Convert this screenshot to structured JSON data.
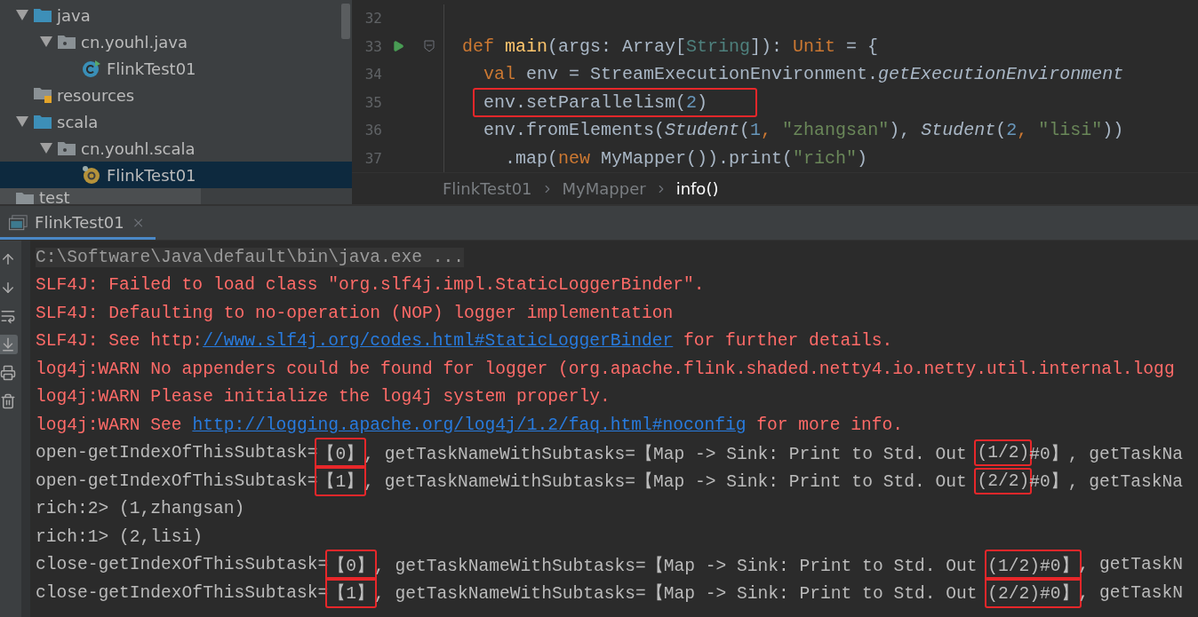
{
  "project_tree": [
    {
      "label": "java",
      "kind": "folder",
      "expanded": true,
      "selected": false,
      "children": [
        {
          "label": "cn.youhl.java",
          "kind": "package",
          "expanded": true,
          "selected": false,
          "children": [
            {
              "label": "FlinkTest01",
              "kind": "class",
              "selected": false
            }
          ]
        }
      ]
    },
    {
      "label": "resources",
      "kind": "resources",
      "selected": false
    },
    {
      "label": "scala",
      "kind": "folder",
      "expanded": true,
      "selected": false,
      "children": [
        {
          "label": "cn.youhl.scala",
          "kind": "package",
          "expanded": true,
          "selected": false,
          "children": [
            {
              "label": "FlinkTest01",
              "kind": "object",
              "selected": true
            }
          ]
        }
      ]
    }
  ],
  "tree_cut_row": {
    "label": "test"
  },
  "editor": {
    "lines": [
      {
        "number": "32",
        "run": false,
        "fold": false,
        "highlighted": false
      },
      {
        "number": "33",
        "run": true,
        "fold": true,
        "highlighted": false,
        "tokens": [
          {
            "kind": "keyword",
            "text": "def "
          },
          {
            "kind": "function",
            "text": "main"
          },
          {
            "kind": "plain",
            "text": "(args: Array["
          },
          {
            "kind": "type",
            "text": "String"
          },
          {
            "kind": "plain",
            "text": "]): "
          },
          {
            "kind": "keyword",
            "text": "Unit"
          },
          {
            "kind": "plain",
            "text": " = {"
          }
        ],
        "children": [
          {
            "number": "34",
            "run": false,
            "fold": false,
            "highlighted": false,
            "tokens": [
              {
                "kind": "keyword",
                "text": "val "
              },
              {
                "kind": "plain",
                "text": "env = StreamExecutionEnvironment."
              },
              {
                "kind": "italic",
                "text": "getExecutionEnvironment"
              }
            ]
          },
          {
            "number": "35",
            "run": false,
            "fold": false,
            "highlighted": true,
            "tokens": [
              {
                "kind": "plain",
                "text": "env.setParallelism("
              },
              {
                "kind": "number",
                "text": "2"
              },
              {
                "kind": "plain",
                "text": ")"
              }
            ]
          },
          {
            "number": "36",
            "run": false,
            "fold": false,
            "highlighted": false,
            "tokens": [
              {
                "kind": "plain",
                "text": "env.fromElements("
              },
              {
                "kind": "italic",
                "text": "Student"
              },
              {
                "kind": "plain",
                "text": "("
              },
              {
                "kind": "number",
                "text": "1"
              },
              {
                "kind": "keyword",
                "text": ", "
              },
              {
                "kind": "string",
                "text": "\"zhangsan\""
              },
              {
                "kind": "plain",
                "text": "), "
              },
              {
                "kind": "italic",
                "text": "Student"
              },
              {
                "kind": "plain",
                "text": "("
              },
              {
                "kind": "number",
                "text": "2"
              },
              {
                "kind": "keyword",
                "text": ", "
              },
              {
                "kind": "string",
                "text": "\"lisi\""
              },
              {
                "kind": "plain",
                "text": "))"
              }
            ],
            "children": [
              {
                "number": "37",
                "run": false,
                "fold": false,
                "highlighted": false,
                "tokens": [
                  {
                    "kind": "plain",
                    "text": ".map("
                  },
                  {
                    "kind": "keyword",
                    "text": "new "
                  },
                  {
                    "kind": "plain",
                    "text": "MyMapper()).print("
                  },
                  {
                    "kind": "string",
                    "text": "\"rich\""
                  },
                  {
                    "kind": "plain",
                    "text": ")"
                  }
                ]
              }
            ]
          }
        ]
      }
    ]
  },
  "breadcrumbs": [
    {
      "label": "FlinkTest01",
      "selected": false
    },
    {
      "label": "MyMapper",
      "selected": false
    },
    {
      "label": "info()",
      "selected": true
    }
  ],
  "run_tab": {
    "title": "FlinkTest01"
  },
  "console_lines": [
    {
      "kind": "command",
      "segments": [
        {
          "kind": "text",
          "text": "C:\\Software\\Java\\default\\bin\\java.exe ..."
        }
      ]
    },
    {
      "kind": "error",
      "segments": [
        {
          "kind": "text",
          "text": "SLF4J: Failed to load class \"org.slf4j.impl.StaticLoggerBinder\"."
        }
      ]
    },
    {
      "kind": "error",
      "segments": [
        {
          "kind": "text",
          "text": "SLF4J: Defaulting to no-operation (NOP) logger implementation"
        }
      ]
    },
    {
      "kind": "error",
      "segments": [
        {
          "kind": "text",
          "text": "SLF4J: See http:"
        },
        {
          "kind": "link",
          "text": "//www.slf4j.org/codes.html#StaticLoggerBinder"
        },
        {
          "kind": "text",
          "text": " for further details."
        }
      ]
    },
    {
      "kind": "error",
      "segments": [
        {
          "kind": "text",
          "text": "log4j:WARN No appenders could be found for logger (org.apache.flink.shaded.netty4.io.netty.util.internal.logg"
        }
      ]
    },
    {
      "kind": "error",
      "segments": [
        {
          "kind": "text",
          "text": "log4j:WARN Please initialize the log4j system properly."
        }
      ]
    },
    {
      "kind": "error",
      "segments": [
        {
          "kind": "text",
          "text": "log4j:WARN See "
        },
        {
          "kind": "link",
          "text": "http://logging.apache.org/log4j/1.2/faq.html#noconfig"
        },
        {
          "kind": "text",
          "text": " for more info."
        }
      ]
    },
    {
      "kind": "output",
      "segments": [
        {
          "kind": "text",
          "text": "open-getIndexOfThisSubtask=",
          "boxed": false
        },
        {
          "kind": "text",
          "text": "【0】",
          "boxed": true
        },
        {
          "kind": "text",
          "text": ", getTaskNameWithSubtasks=【Map -> Sink: Print to Std. Out ",
          "boxed": false
        },
        {
          "kind": "text",
          "text": "(1/2)",
          "boxed": true
        },
        {
          "kind": "text",
          "text": "#0】, getTaskNa",
          "boxed": false
        }
      ]
    },
    {
      "kind": "output",
      "segments": [
        {
          "kind": "text",
          "text": "open-getIndexOfThisSubtask=",
          "boxed": false
        },
        {
          "kind": "text",
          "text": "【1】",
          "boxed": true
        },
        {
          "kind": "text",
          "text": ", getTaskNameWithSubtasks=【Map -> Sink: Print to Std. Out ",
          "boxed": false
        },
        {
          "kind": "text",
          "text": "(2/2)",
          "boxed": true
        },
        {
          "kind": "text",
          "text": "#0】, getTaskNa",
          "boxed": false
        }
      ]
    },
    {
      "kind": "output",
      "segments": [
        {
          "kind": "text",
          "text": "rich:2> (1,zhangsan)",
          "boxed": false
        }
      ]
    },
    {
      "kind": "output",
      "segments": [
        {
          "kind": "text",
          "text": "rich:1> (2,lisi)",
          "boxed": false
        }
      ]
    },
    {
      "kind": "output",
      "segments": [
        {
          "kind": "text",
          "text": "close-getIndexOfThisSubtask=",
          "boxed": false
        },
        {
          "kind": "text",
          "text": "【0】",
          "boxed": true
        },
        {
          "kind": "text",
          "text": ", getTaskNameWithSubtasks=【Map -> Sink: Print to Std. Out ",
          "boxed": false
        },
        {
          "kind": "text",
          "text": "(1/2)#0】",
          "boxed": true
        },
        {
          "kind": "text",
          "text": ", getTaskN",
          "boxed": false
        }
      ]
    },
    {
      "kind": "output",
      "segments": [
        {
          "kind": "text",
          "text": "close-getIndexOfThisSubtask=",
          "boxed": false
        },
        {
          "kind": "text",
          "text": "【1】",
          "boxed": true
        },
        {
          "kind": "text",
          "text": ", getTaskNameWithSubtasks=【Map -> Sink: Print to Std. Out ",
          "boxed": false
        },
        {
          "kind": "text",
          "text": "(2/2)#0】",
          "boxed": true
        },
        {
          "kind": "text",
          "text": ", getTaskN",
          "boxed": false
        }
      ]
    }
  ]
}
